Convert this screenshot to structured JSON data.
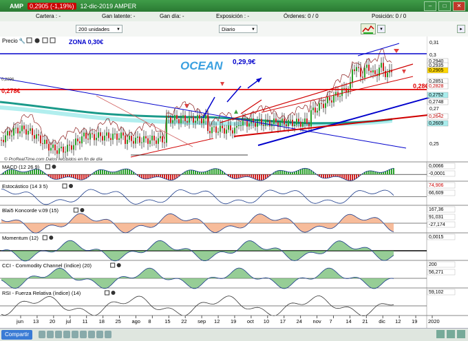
{
  "window": {
    "app": "AMP",
    "price_badge": "0,2905 (-1,19%)",
    "date_label": "12-dic-2019 AMPER"
  },
  "infobar": {
    "cartera": "Cartera : -",
    "gan_latente": "Gan latente: -",
    "gan_dia": "Gan día: -",
    "exposicion": "Exposición : -",
    "ordenes": "Órdenes: 0 / 0",
    "posicion": "Posición: 0 / 0"
  },
  "toolbar": {
    "units": "200 unidades",
    "period": "Diario"
  },
  "price_panel": {
    "label": "Precio",
    "zona": "ZONA 0,30€",
    "ocean": "OCEAN",
    "annot_299": "0,29,9€",
    "annot_028": "0,28€",
    "annot_0278": "0,278€",
    "annot_02896": "0,2896",
    "credit": "© ProRealTime.com Datos recibidos en fin de día",
    "axis_ticks": [
      "0,31",
      "0,3",
      "0,29",
      "0,28",
      "0,27",
      "0,26",
      "0,25"
    ],
    "price_tags": [
      {
        "text": "0,2940",
        "color": "#ffffff",
        "fg": "#000000"
      },
      {
        "text": "0,2935",
        "color": "#ffffff",
        "fg": "#000000"
      },
      {
        "text": "0,2905",
        "color": "#ffd700",
        "fg": "#000000"
      },
      {
        "text": "0,2851",
        "color": "#ffffff",
        "fg": "#000000"
      },
      {
        "text": "0,2828",
        "color": "#ffffff",
        "fg": "#c00000"
      },
      {
        "text": "0,2752",
        "color": "#a8ecec",
        "fg": "#000000"
      },
      {
        "text": "0,2748",
        "color": "#ffffff",
        "fg": "#000000"
      },
      {
        "text": "0,2642",
        "color": "#ffffff",
        "fg": "#c00000"
      },
      {
        "text": "0,2609",
        "color": "#a8ecec",
        "fg": "#000000"
      }
    ]
  },
  "indicators": [
    {
      "label": "MACD (12 26 9)",
      "values": [
        "0,0066",
        "-0,0001"
      ]
    },
    {
      "label": "Estocástico (14 3 5)",
      "values": [
        "74,906",
        "66,609"
      ]
    },
    {
      "label": "Blai5 Koncorde v.09 (15)",
      "values": [
        "167,36",
        "91,031",
        "-27,174"
      ]
    },
    {
      "label": "Momentum (12)",
      "values": [
        "0,0015"
      ]
    },
    {
      "label": "CCI - Commodity Channel (índice) (20)",
      "values": [
        "200",
        "56,271"
      ]
    },
    {
      "label": "RSI - Fuerza Relativa (índice) (14)",
      "values": [
        "59,102"
      ]
    }
  ],
  "x_axis": [
    "jun",
    "13",
    "20",
    "jul",
    "11",
    "18",
    "25",
    "ago",
    "8",
    "15",
    "22",
    "sep",
    "12",
    "19",
    "oct",
    "10",
    "17",
    "24",
    "nov",
    "7",
    "14",
    "21",
    "dic",
    "12",
    "19",
    "2020"
  ],
  "status": {
    "share": "Compartir"
  },
  "colors": {
    "title_green": "#2e8b3a",
    "price_red": "#cc0000",
    "zone_blue": "#0000cc",
    "ocean_blue": "#3aa0e0"
  }
}
